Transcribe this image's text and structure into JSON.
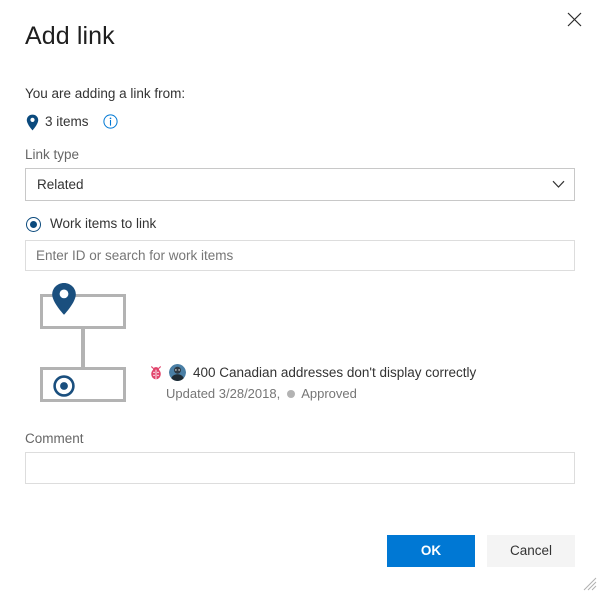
{
  "dialog": {
    "title": "Add link",
    "close_icon": "close-icon"
  },
  "source": {
    "from_label": "You are adding a link from:",
    "pin_icon": "map-pin-icon",
    "items_count": "3 items",
    "info_icon": "info-circle-icon"
  },
  "link_type": {
    "label": "Link type",
    "selected": "Related",
    "chevron_icon": "chevron-down-icon",
    "options": [
      "Related"
    ]
  },
  "work_items": {
    "radio_label": "Work items to link",
    "radio_icon": "radio-selected-icon",
    "search_value": "",
    "search_placeholder": "Enter ID or search for work items"
  },
  "tree": {
    "parent_icon": "map-pin-icon",
    "child_icon": "target-icon"
  },
  "result": {
    "type_icon": "bug-icon",
    "avatar_icon": "avatar-icon",
    "title": "400 Canadian addresses don't display correctly",
    "updated": "Updated 3/28/2018,",
    "state_dot": "state-dot-icon",
    "state": "Approved"
  },
  "comment": {
    "label": "Comment",
    "value": "",
    "placeholder": ""
  },
  "footer": {
    "ok_label": "OK",
    "cancel_label": "Cancel"
  },
  "colors": {
    "accent": "#0078d4",
    "pin_blue": "#0b4a7d",
    "bug_red": "#e1436b",
    "border": "#c8c8c8",
    "input_border": "#dddddd",
    "tree_gray": "#b3b3b3",
    "muted_text": "#767676"
  }
}
